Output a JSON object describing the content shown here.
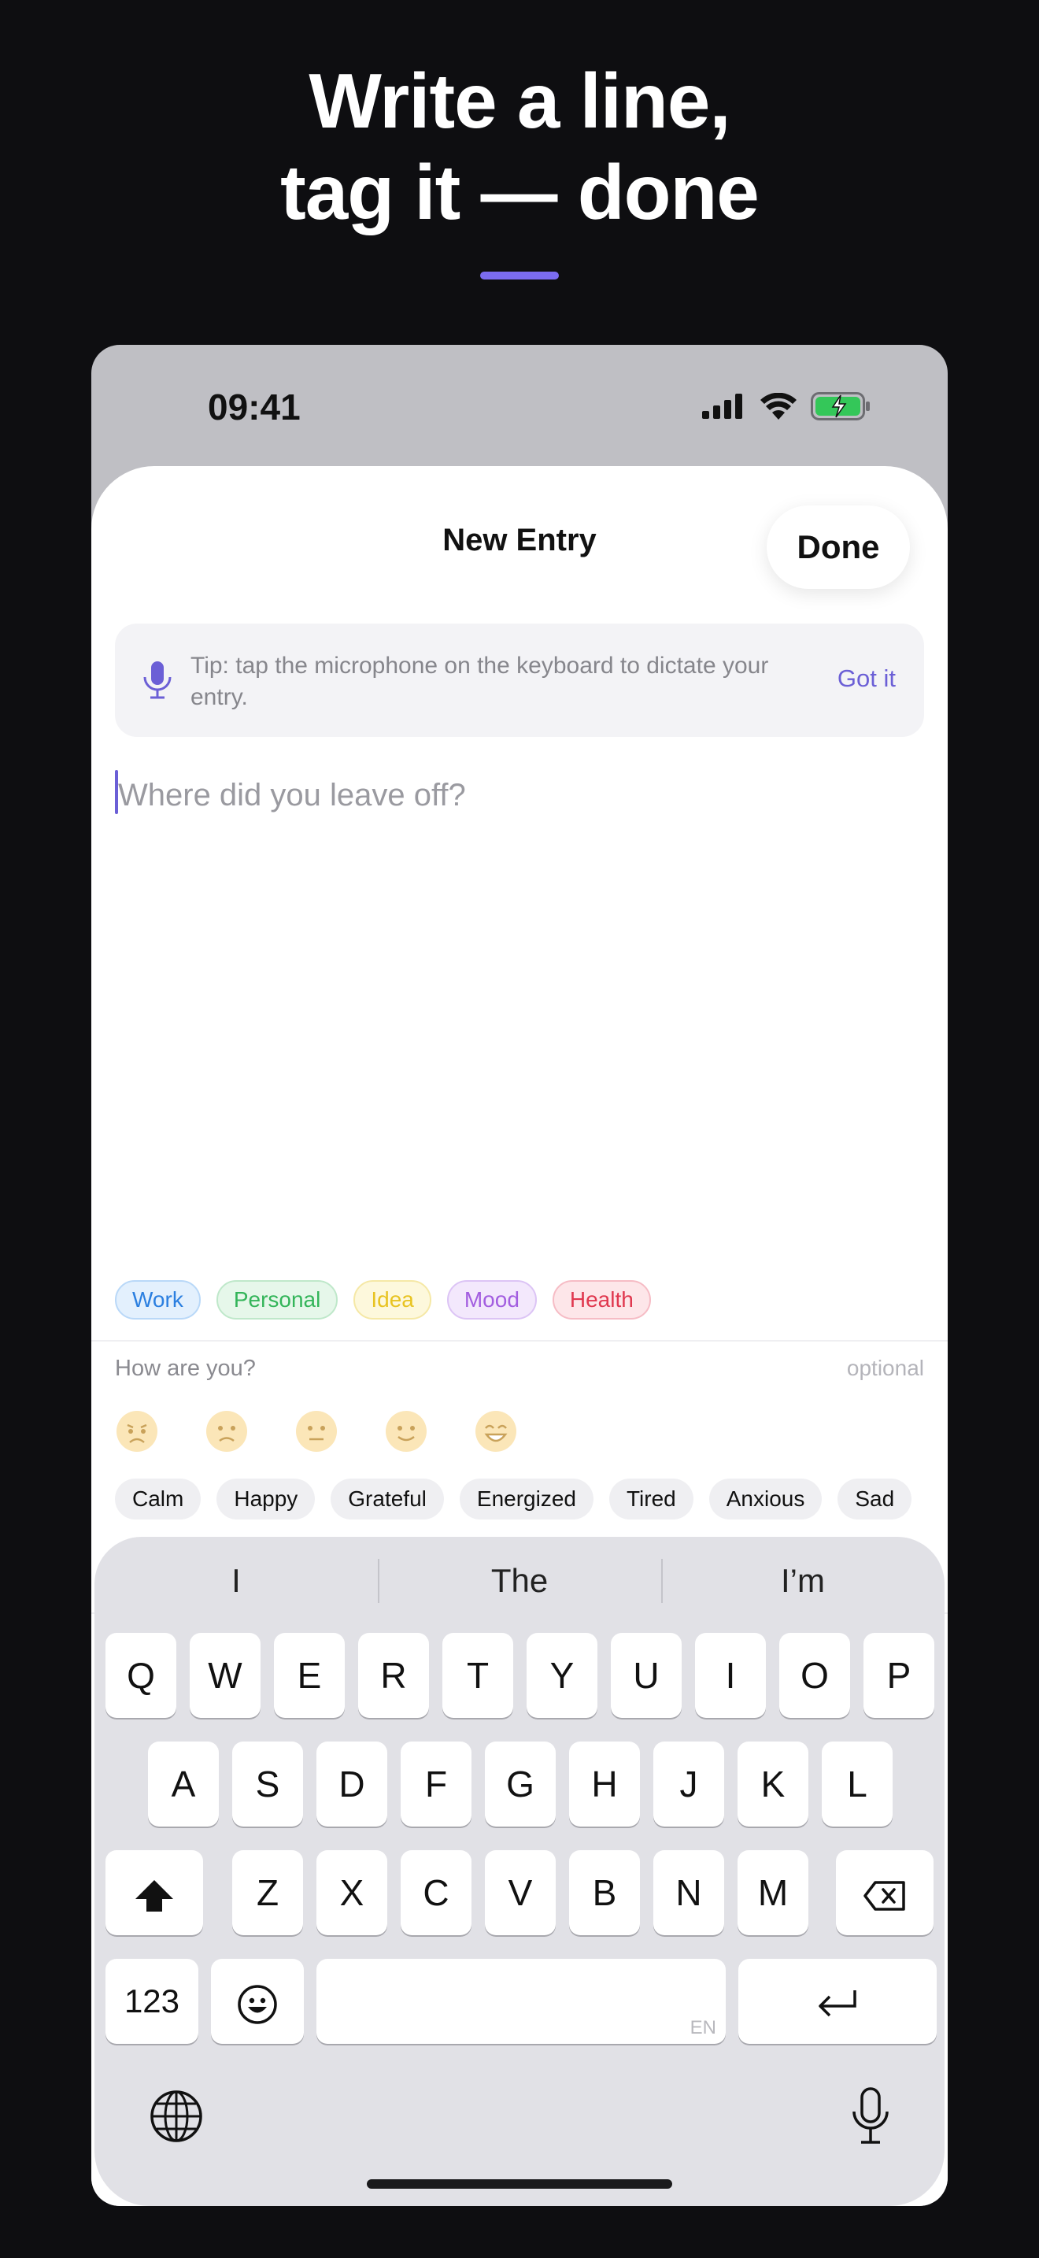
{
  "headline": {
    "line1": "Write a line,",
    "line2": "tag it — done"
  },
  "status": {
    "time": "09:41"
  },
  "sheet": {
    "title": "New Entry",
    "done_label": "Done"
  },
  "tip": {
    "text": "Tip: tap the microphone on the keyboard to dictate your entry.",
    "action": "Got it"
  },
  "editor": {
    "placeholder": "Where did you leave off?",
    "value": ""
  },
  "tags": [
    {
      "label": "Work",
      "color": "#2b7fe0",
      "bg": "#e3f0fd",
      "border": "#b9d8f8"
    },
    {
      "label": "Personal",
      "color": "#34b55a",
      "bg": "#e6f7ea",
      "border": "#bfe8ca"
    },
    {
      "label": "Idea",
      "color": "#e8c321",
      "bg": "#fdf8dc",
      "border": "#f5e8a6"
    },
    {
      "label": "Mood",
      "color": "#a35ee0",
      "bg": "#f3e8fc",
      "border": "#dcc4f5"
    },
    {
      "label": "Health",
      "color": "#e0384f",
      "bg": "#fde6e9",
      "border": "#f6bcc5"
    }
  ],
  "mood": {
    "label": "How are you?",
    "optional": "optional",
    "faces": [
      "very-sad-face-icon",
      "sad-face-icon",
      "neutral-face-icon",
      "smile-face-icon",
      "grin-face-icon"
    ],
    "chips": [
      "Calm",
      "Happy",
      "Grateful",
      "Energized",
      "Tired",
      "Anxious",
      "Sad"
    ]
  },
  "keyboard": {
    "suggestions": [
      "I",
      "The",
      "I’m"
    ],
    "row1": [
      "Q",
      "W",
      "E",
      "R",
      "T",
      "Y",
      "U",
      "I",
      "O",
      "P"
    ],
    "row2": [
      "A",
      "S",
      "D",
      "F",
      "G",
      "H",
      "J",
      "K",
      "L"
    ],
    "row3": [
      "Z",
      "X",
      "C",
      "V",
      "B",
      "N",
      "M"
    ],
    "numbers_label": "123",
    "space_lang": "EN"
  },
  "colors": {
    "accent": "#7b6cf0",
    "link": "#6b5fd6",
    "background": "#0e0e11"
  }
}
